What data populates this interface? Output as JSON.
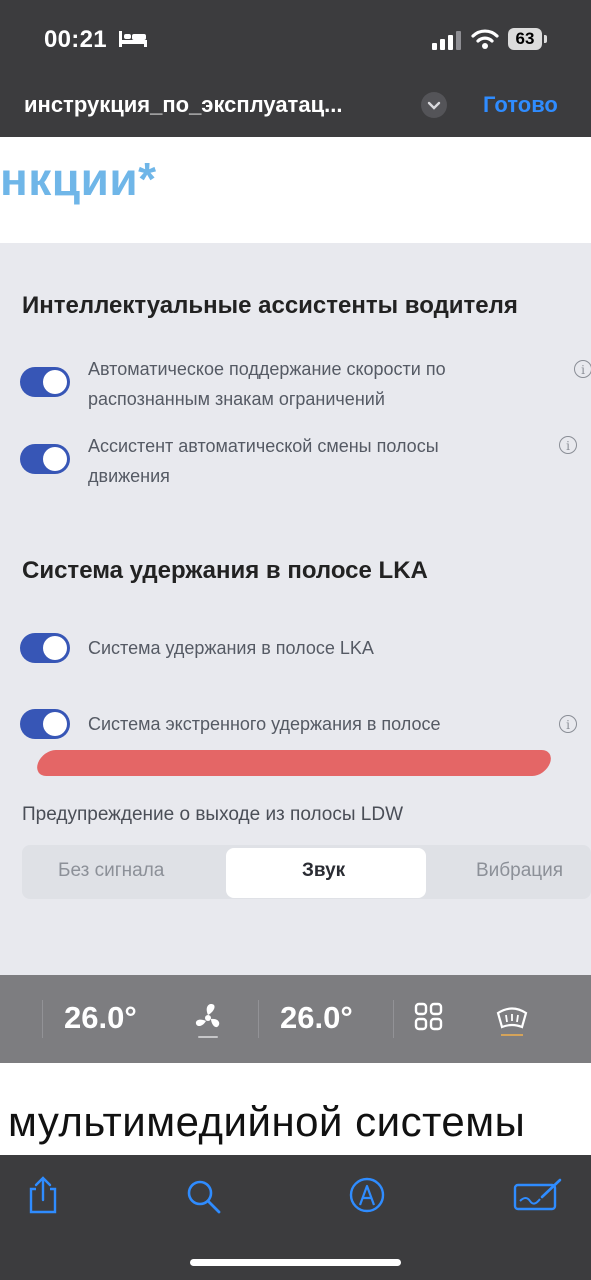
{
  "status_bar": {
    "time": "00:21",
    "battery": "63"
  },
  "header": {
    "document_title": "инструкция_по_эксплуатац...",
    "done_label": "Готово"
  },
  "document": {
    "heading": "нкции*",
    "bottom_text": "мультимедийной системы"
  },
  "screen": {
    "section1_title": "Интеллектуальные ассистенты водителя",
    "items": [
      {
        "line1": "Автоматическое поддержание скорости по",
        "line2": "распознанным знакам ограничений",
        "on": true
      },
      {
        "line1": "Ассистент автоматической смены полосы",
        "line2": "движения",
        "on": true
      }
    ],
    "section2_title": "Система удержания в полосе LKA",
    "lka_items": [
      {
        "label": "Система удержания в полосе LKA",
        "on": true
      },
      {
        "label": "Система экстренного удержания в полосе",
        "on": true
      }
    ],
    "ldw_label": "Предупреждение о выходе из полосы LDW",
    "ldw_options": [
      "Без сигнала",
      "Звук",
      "Вибрация"
    ],
    "ldw_selected": "Звук",
    "info_symbol": "i"
  },
  "car_bar": {
    "temp_left": "26.0°",
    "temp_right": "26.0°"
  },
  "colors": {
    "accent": "#2f8cff",
    "toggle": "#3756b6",
    "heading": "#6fb6e8",
    "highlight": "#e35a5a"
  },
  "icons": [
    "bed-icon",
    "signal-icon",
    "wifi-icon",
    "battery-icon",
    "chevron-down-icon",
    "fan-icon",
    "grid-icon",
    "defrost-icon",
    "share-icon",
    "search-icon",
    "markup-icon",
    "signature-icon"
  ]
}
